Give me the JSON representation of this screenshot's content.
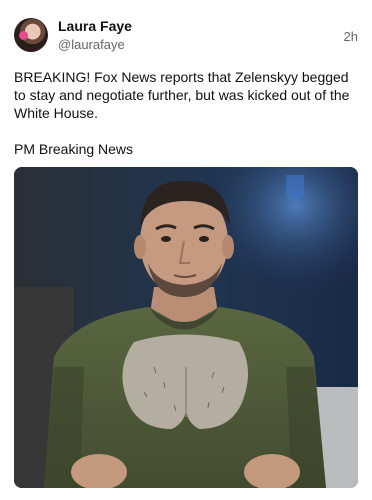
{
  "post": {
    "author": {
      "display_name": "Laura Faye",
      "handle": "@laurafaye"
    },
    "timestamp": "2h",
    "text_lines": [
      "BREAKING! Fox News reports that Zelenskyy begged to stay and negotiate further, but was kicked out of the White House.",
      "PM Breaking News"
    ]
  },
  "colors": {
    "text": "#111111",
    "secondary_text": "#666666",
    "background": "#ffffff"
  }
}
